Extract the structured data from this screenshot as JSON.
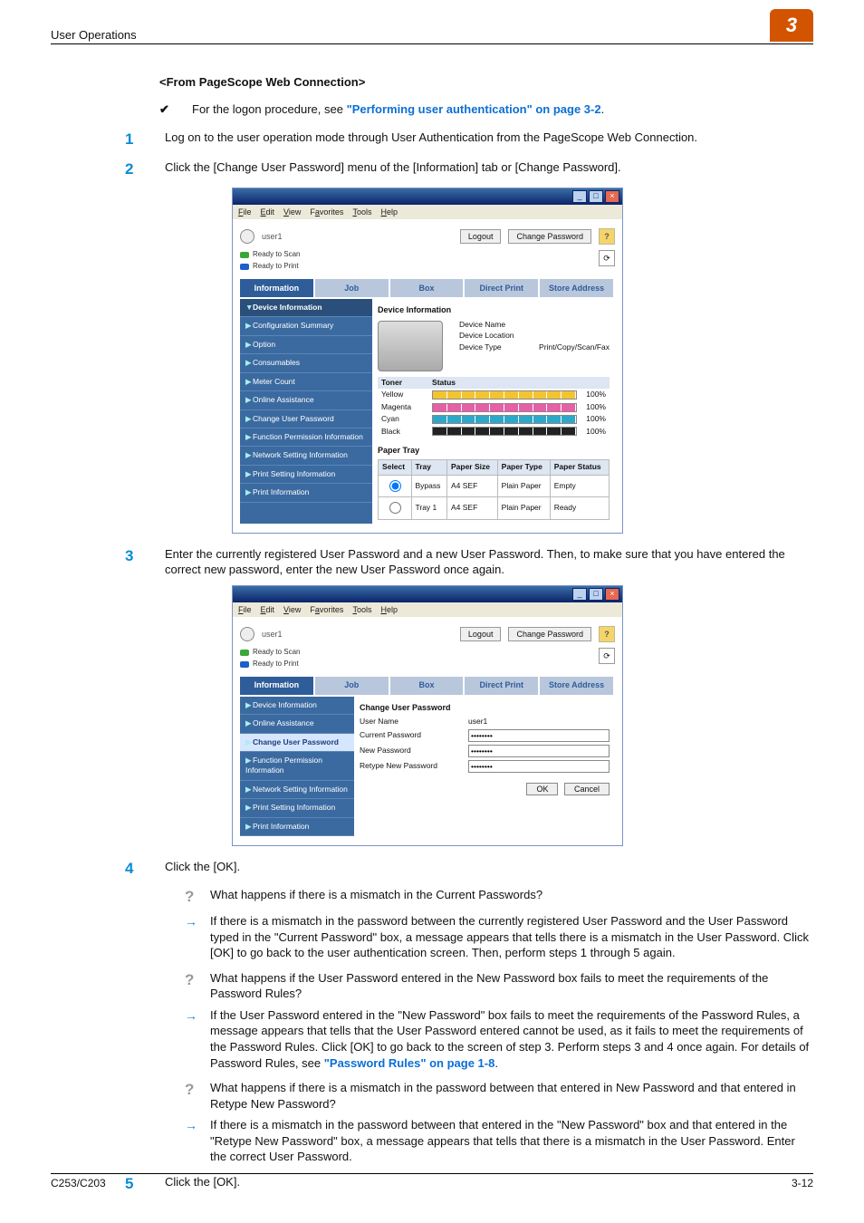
{
  "header": {
    "title": "User Operations",
    "chapter": "3"
  },
  "footer": {
    "left": "C253/C203",
    "right": "3-12"
  },
  "subhead": "<From PageScope Web Connection>",
  "intro": {
    "lead": "For the logon procedure, see ",
    "link": "\"Performing user authentication\" on page 3-2",
    "tail": "."
  },
  "steps": {
    "1": "Log on to the user operation mode through User Authentication from the PageScope Web Connection.",
    "2": "Click the [Change User Password] menu of the [Information] tab or [Change Password].",
    "3": "Enter the currently registered User Password and a new User Password. Then, to make sure that you have entered the correct new password, enter the new User Password once again.",
    "4": "Click the [OK].",
    "5": "Click the [OK]."
  },
  "faq": {
    "q1": "What happens if there is a mismatch in the Current Passwords?",
    "a1": "If there is a mismatch in the password between the currently registered User Password and the User Password typed in the \"Current Password\" box, a message appears that tells there is a mismatch in the User Password. Click [OK] to go back to the user authentication screen. Then, perform steps 1 through 5 again.",
    "q2": "What happens if the User Password entered in the New Password box fails to meet the requirements of the Password Rules?",
    "a2_lead": "If the User Password entered in the \"New Password\" box fails to meet the requirements of the Password Rules, a message appears that tells that the User Password entered cannot be used, as it fails to meet the requirements of the Password Rules. Click [OK] to go back to the screen of step 3. Perform steps 3 and 4 once again. For details of Password Rules, see ",
    "a2_link": "\"Password Rules\" on page 1-8",
    "a2_tail": ".",
    "q3": "What happens if there is a mismatch in the password between that entered in New Password and that entered in Retype New Password?",
    "a3": "If there is a mismatch in the password between that entered in the \"New Password\" box and that entered in the \"Retype New Password\" box, a message appears that tells that there is a mismatch in the User Password. Enter the correct User Password."
  },
  "browser": {
    "menu": [
      "File",
      "Edit",
      "View",
      "Favorites",
      "Tools",
      "Help"
    ],
    "user": "user1",
    "logout": "Logout",
    "change_pw": "Change Password",
    "ready_scan": "Ready to Scan",
    "ready_print": "Ready to Print",
    "tabs": [
      "Information",
      "Job",
      "Box",
      "Direct Print",
      "Store Address"
    ]
  },
  "shot1": {
    "side": [
      "Device Information",
      "Configuration Summary",
      "Option",
      "Consumables",
      "Meter Count",
      "Online Assistance",
      "Change User Password",
      "Function Permission Information",
      "Network Setting Information",
      "Print Setting Information",
      "Print Information"
    ],
    "dev_heading": "Device Information",
    "dev": {
      "name_k": "Device Name",
      "name_v": "",
      "loc_k": "Device Location",
      "loc_v": "",
      "type_k": "Device Type",
      "type_v": "Print/Copy/Scan/Fax"
    },
    "toner_header": [
      "Toner",
      "Status"
    ],
    "toner": [
      {
        "name": "Yellow",
        "pct": "100%",
        "cls": "y"
      },
      {
        "name": "Magenta",
        "pct": "100%",
        "cls": "m"
      },
      {
        "name": "Cyan",
        "pct": "100%",
        "cls": "c"
      },
      {
        "name": "Black",
        "pct": "100%",
        "cls": "k"
      }
    ],
    "paper_heading": "Paper Tray",
    "paper_cols": [
      "Select",
      "Tray",
      "Paper Size",
      "Paper Type",
      "Paper Status"
    ],
    "paper_rows": [
      {
        "sel": true,
        "tray": "Bypass",
        "size": "A4 SEF",
        "type": "Plain Paper",
        "status": "Empty"
      },
      {
        "sel": false,
        "tray": "Tray 1",
        "size": "A4 SEF",
        "type": "Plain Paper",
        "status": "Ready"
      }
    ]
  },
  "shot2": {
    "side": [
      "Device Information",
      "Online Assistance",
      "Change User Password",
      "Function Permission Information",
      "Network Setting Information",
      "Print Setting Information",
      "Print Information"
    ],
    "heading": "Change User Password",
    "rows": {
      "uname_k": "User Name",
      "uname_v": "user1",
      "cur_k": "Current Password",
      "cur_v": "••••••••",
      "new_k": "New Password",
      "new_v": "••••••••",
      "re_k": "Retype New Password",
      "re_v": "••••••••"
    },
    "ok": "OK",
    "cancel": "Cancel"
  }
}
